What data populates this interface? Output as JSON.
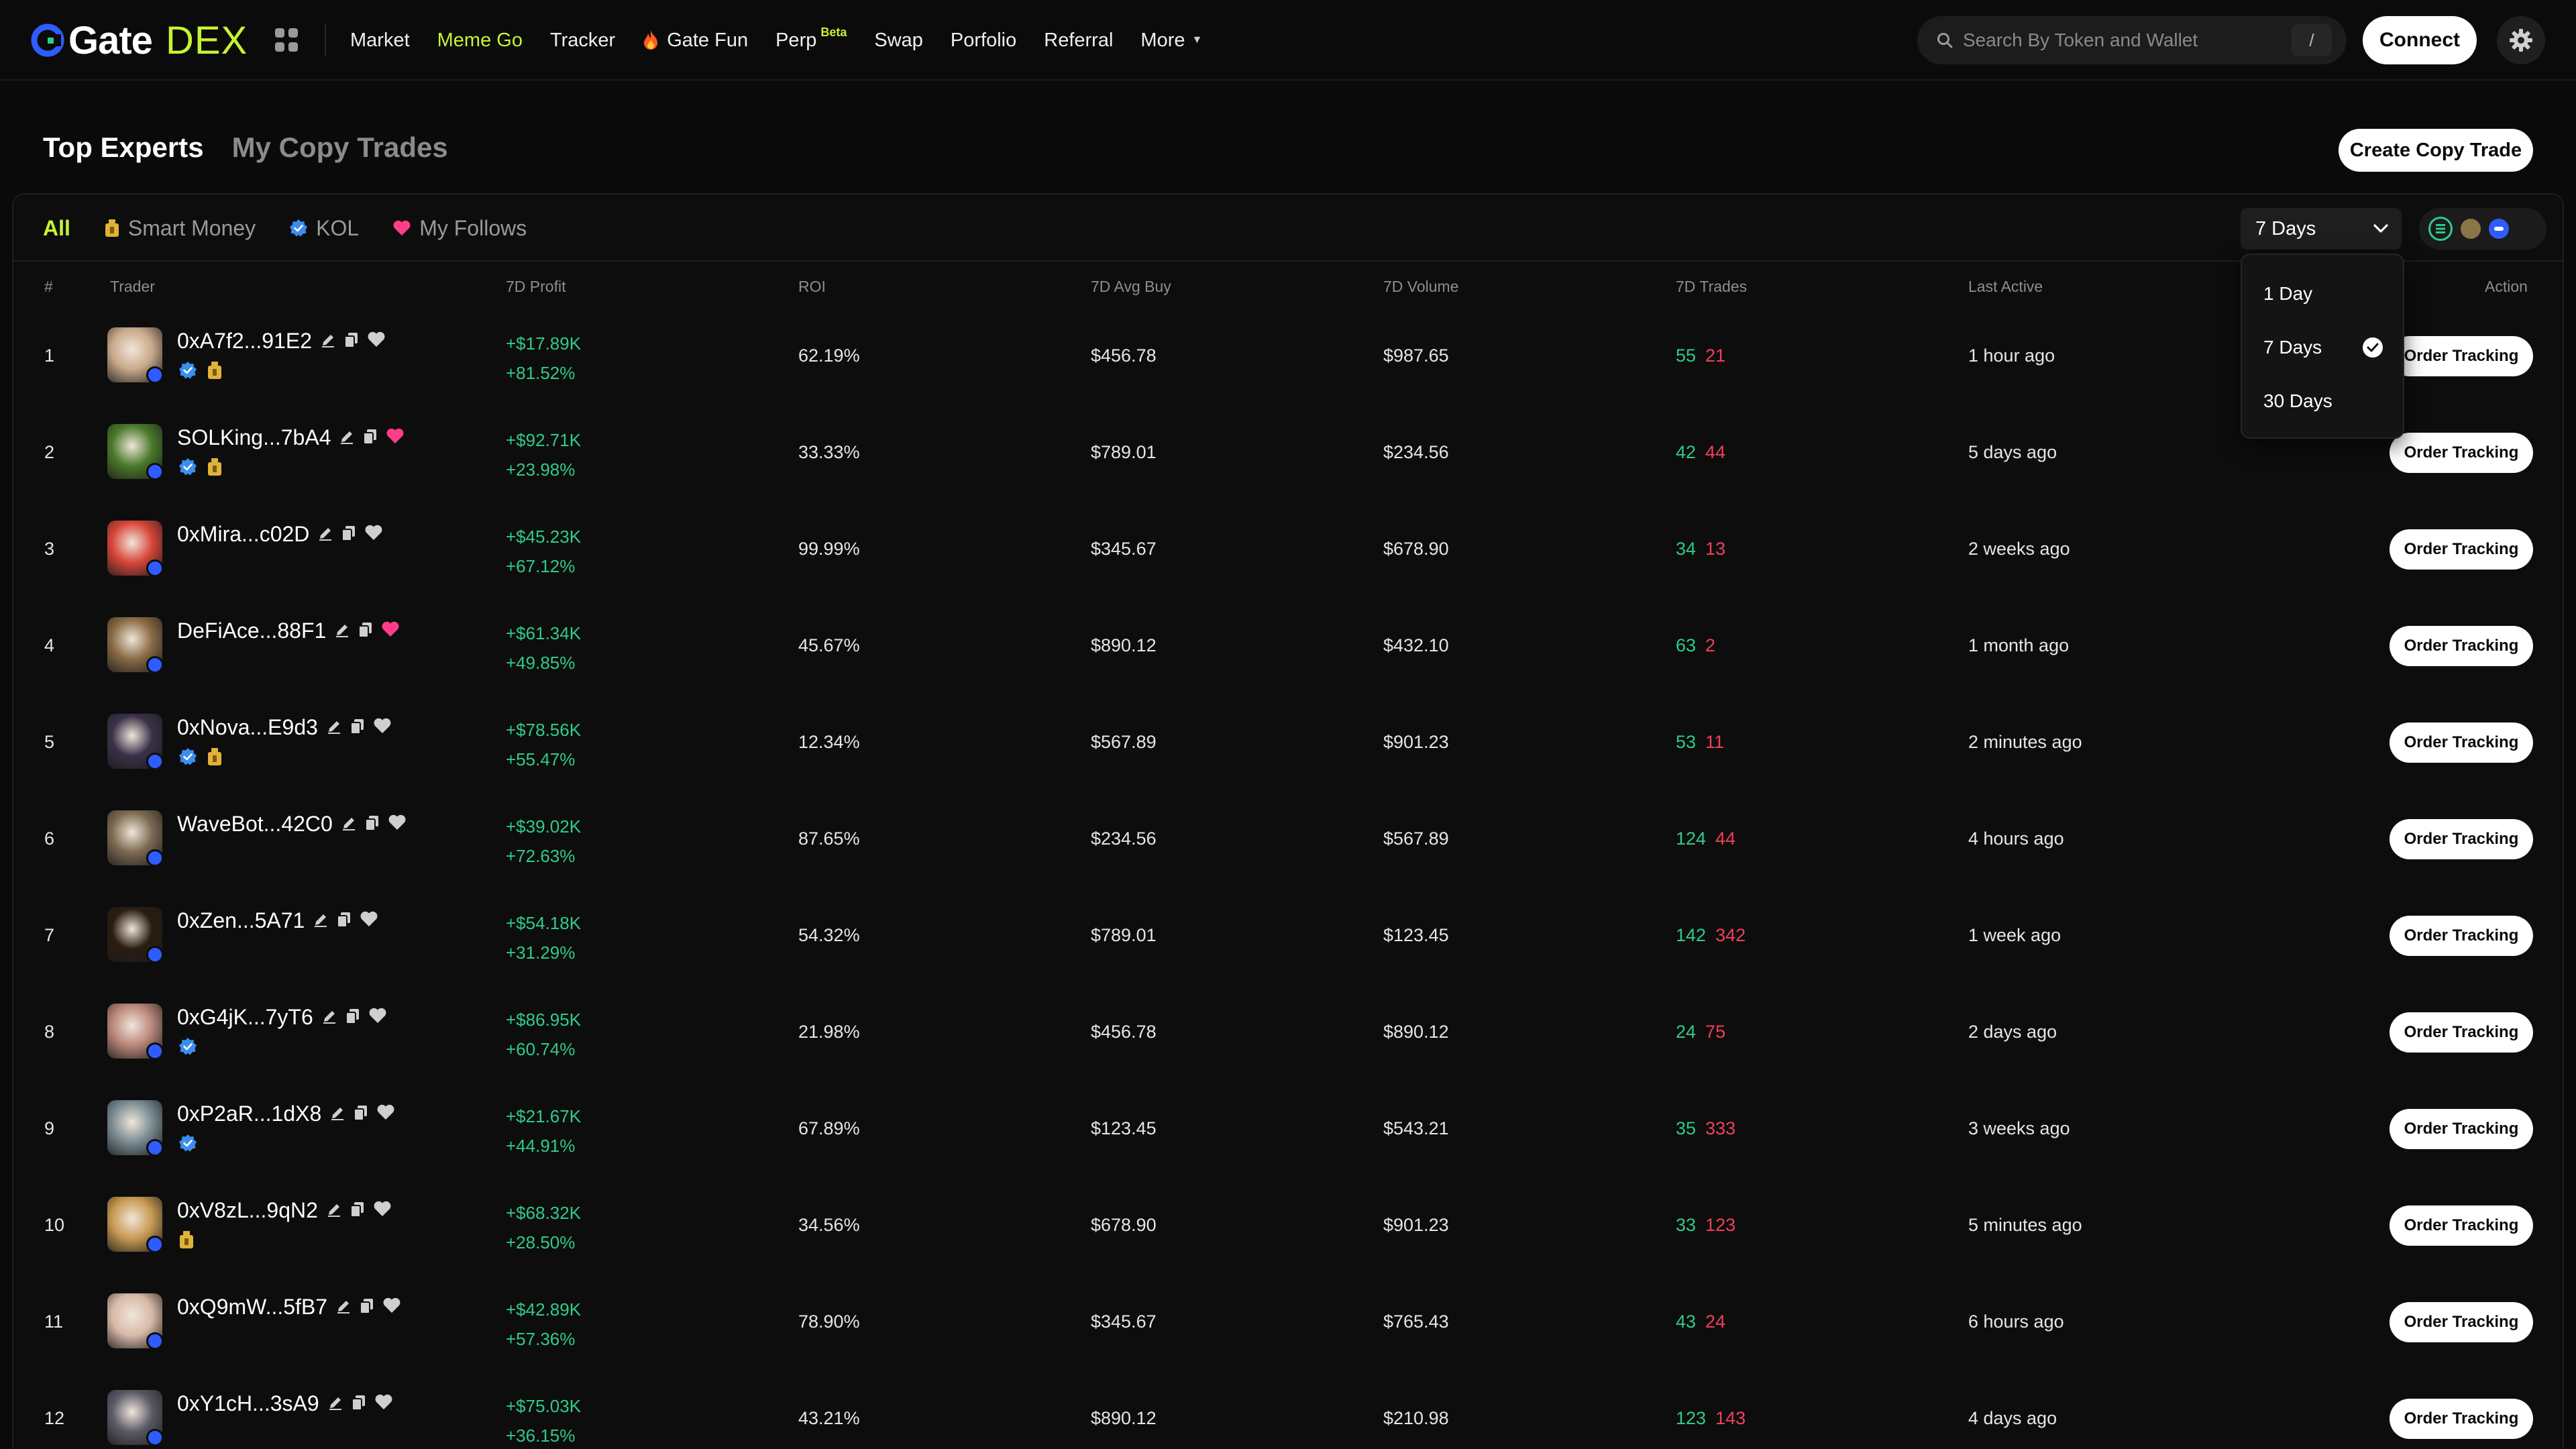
{
  "brand": {
    "name_a": "Gate",
    "name_b": "DEX",
    "accent": "#c6f432"
  },
  "nav": {
    "items": [
      {
        "label": "Market",
        "active": false
      },
      {
        "label": "Meme Go",
        "active": true
      },
      {
        "label": "Tracker",
        "active": false
      },
      {
        "label": "Gate Fun",
        "active": false,
        "icon": "fire-icon"
      },
      {
        "label": "Perp",
        "active": false,
        "badge": "Beta"
      },
      {
        "label": "Swap",
        "active": false
      },
      {
        "label": "Porfolio",
        "active": false
      },
      {
        "label": "Referral",
        "active": false
      },
      {
        "label": "More",
        "active": false,
        "icon": "caret-down-icon"
      }
    ],
    "search_placeholder": "Search By Token and Wallet",
    "search_shortcut": "/",
    "connect_label": "Connect"
  },
  "header": {
    "tabs": [
      {
        "label": "Top Experts",
        "active": true
      },
      {
        "label": "My Copy Trades",
        "active": false
      }
    ],
    "create_label": "Create Copy Trade"
  },
  "filters": {
    "items": [
      {
        "label": "All",
        "active": true
      },
      {
        "label": "Smart Money",
        "icon": "moneybag-icon"
      },
      {
        "label": "KOL",
        "icon": "verified-icon"
      },
      {
        "label": "My Follows",
        "icon": "heart-icon"
      }
    ],
    "period_selected": "7 Days",
    "chains": [
      {
        "icon": "solana-chain-icon",
        "color": "#2ecc8a"
      },
      {
        "icon": "bsc-chain-icon",
        "color": "#c9a24a"
      },
      {
        "icon": "base-chain-icon",
        "color": "#2f5cff"
      }
    ]
  },
  "dropdown": {
    "options": [
      {
        "label": "1 Day",
        "selected": false
      },
      {
        "label": "7 Days",
        "selected": true
      },
      {
        "label": "30 Days",
        "selected": false
      }
    ]
  },
  "table": {
    "headers": {
      "rank": "#",
      "trader": "Trader",
      "profit": "7D Profit",
      "roi": "ROI",
      "avg": "7D Avg Buy",
      "vol": "7D Volume",
      "trades": "7D Trades",
      "last": "Last Active",
      "action": "Action"
    },
    "action_label": "Order Tracking",
    "rows": [
      {
        "rank": "1",
        "name": "0xA7f2...91E2",
        "profit": "+$17.89K",
        "profit_pct": "+81.52%",
        "roi": "62.19%",
        "avg": "$456.78",
        "vol": "$987.65",
        "buys": "55",
        "sells": "21",
        "last": "1 hour ago",
        "kol": true,
        "smart": true,
        "followed": false,
        "avatar": "#c9a98b"
      },
      {
        "rank": "2",
        "name": "SOLKing...7bA4",
        "profit": "+$92.71K",
        "profit_pct": "+23.98%",
        "roi": "33.33%",
        "avg": "$789.01",
        "vol": "$234.56",
        "buys": "42",
        "sells": "44",
        "last": "5 days ago",
        "kol": true,
        "smart": true,
        "followed": true,
        "avatar": "#4b7a2a"
      },
      {
        "rank": "3",
        "name": "0xMira...c02D",
        "profit": "+$45.23K",
        "profit_pct": "+67.12%",
        "roi": "99.99%",
        "avg": "$345.67",
        "vol": "$678.90",
        "buys": "34",
        "sells": "13",
        "last": "2 weeks ago",
        "kol": false,
        "smart": false,
        "followed": false,
        "avatar": "#d9463a"
      },
      {
        "rank": "4",
        "name": "DeFiAce...88F1",
        "profit": "+$61.34K",
        "profit_pct": "+49.85%",
        "roi": "45.67%",
        "avg": "$890.12",
        "vol": "$432.10",
        "buys": "63",
        "sells": "2",
        "last": "1 month ago",
        "kol": false,
        "smart": false,
        "followed": true,
        "avatar": "#8a6b45"
      },
      {
        "rank": "5",
        "name": "0xNova...E9d3",
        "profit": "+$78.56K",
        "profit_pct": "+55.47%",
        "roi": "12.34%",
        "avg": "$567.89",
        "vol": "$901.23",
        "buys": "53",
        "sells": "11",
        "last": "2 minutes ago",
        "kol": true,
        "smart": true,
        "followed": false,
        "avatar": "#3a3148"
      },
      {
        "rank": "6",
        "name": "WaveBot...42C0",
        "profit": "+$39.02K",
        "profit_pct": "+72.63%",
        "roi": "87.65%",
        "avg": "$234.56",
        "vol": "$567.89",
        "buys": "124",
        "sells": "44",
        "last": "4 hours ago",
        "kol": false,
        "smart": false,
        "followed": false,
        "avatar": "#7d6a52"
      },
      {
        "rank": "7",
        "name": "0xZen...5A71",
        "profit": "+$54.18K",
        "profit_pct": "+31.29%",
        "roi": "54.32%",
        "avg": "$789.01",
        "vol": "$123.45",
        "buys": "142",
        "sells": "342",
        "last": "1 week ago",
        "kol": false,
        "smart": false,
        "followed": false,
        "avatar": "#2a1c10"
      },
      {
        "rank": "8",
        "name": "0xG4jK...7yT6",
        "profit": "+$86.95K",
        "profit_pct": "+60.74%",
        "roi": "21.98%",
        "avg": "$456.78",
        "vol": "$890.12",
        "buys": "24",
        "sells": "75",
        "last": "2 days ago",
        "kol": true,
        "smart": false,
        "followed": false,
        "avatar": "#b9877a"
      },
      {
        "rank": "9",
        "name": "0xP2aR...1dX8",
        "profit": "+$21.67K",
        "profit_pct": "+44.91%",
        "roi": "67.89%",
        "avg": "$123.45",
        "vol": "$543.21",
        "buys": "35",
        "sells": "333",
        "last": "3 weeks ago",
        "kol": true,
        "smart": false,
        "followed": false,
        "avatar": "#7a8c93"
      },
      {
        "rank": "10",
        "name": "0xV8zL...9qN2",
        "profit": "+$68.32K",
        "profit_pct": "+28.50%",
        "roi": "34.56%",
        "avg": "$678.90",
        "vol": "$901.23",
        "buys": "33",
        "sells": "123",
        "last": "5 minutes ago",
        "kol": false,
        "smart": true,
        "followed": false,
        "avatar": "#c79a52"
      },
      {
        "rank": "11",
        "name": "0xQ9mW...5fB7",
        "profit": "+$42.89K",
        "profit_pct": "+57.36%",
        "roi": "78.90%",
        "avg": "$345.67",
        "vol": "$765.43",
        "buys": "43",
        "sells": "24",
        "last": "6 hours ago",
        "kol": false,
        "smart": false,
        "followed": false,
        "avatar": "#d7b9a8"
      },
      {
        "rank": "12",
        "name": "0xY1cH...3sA9",
        "profit": "+$75.03K",
        "profit_pct": "+36.15%",
        "roi": "43.21%",
        "avg": "$890.12",
        "vol": "$210.98",
        "buys": "123",
        "sells": "143",
        "last": "4 days ago",
        "kol": false,
        "smart": false,
        "followed": false,
        "avatar": "#5a5a66"
      }
    ]
  }
}
